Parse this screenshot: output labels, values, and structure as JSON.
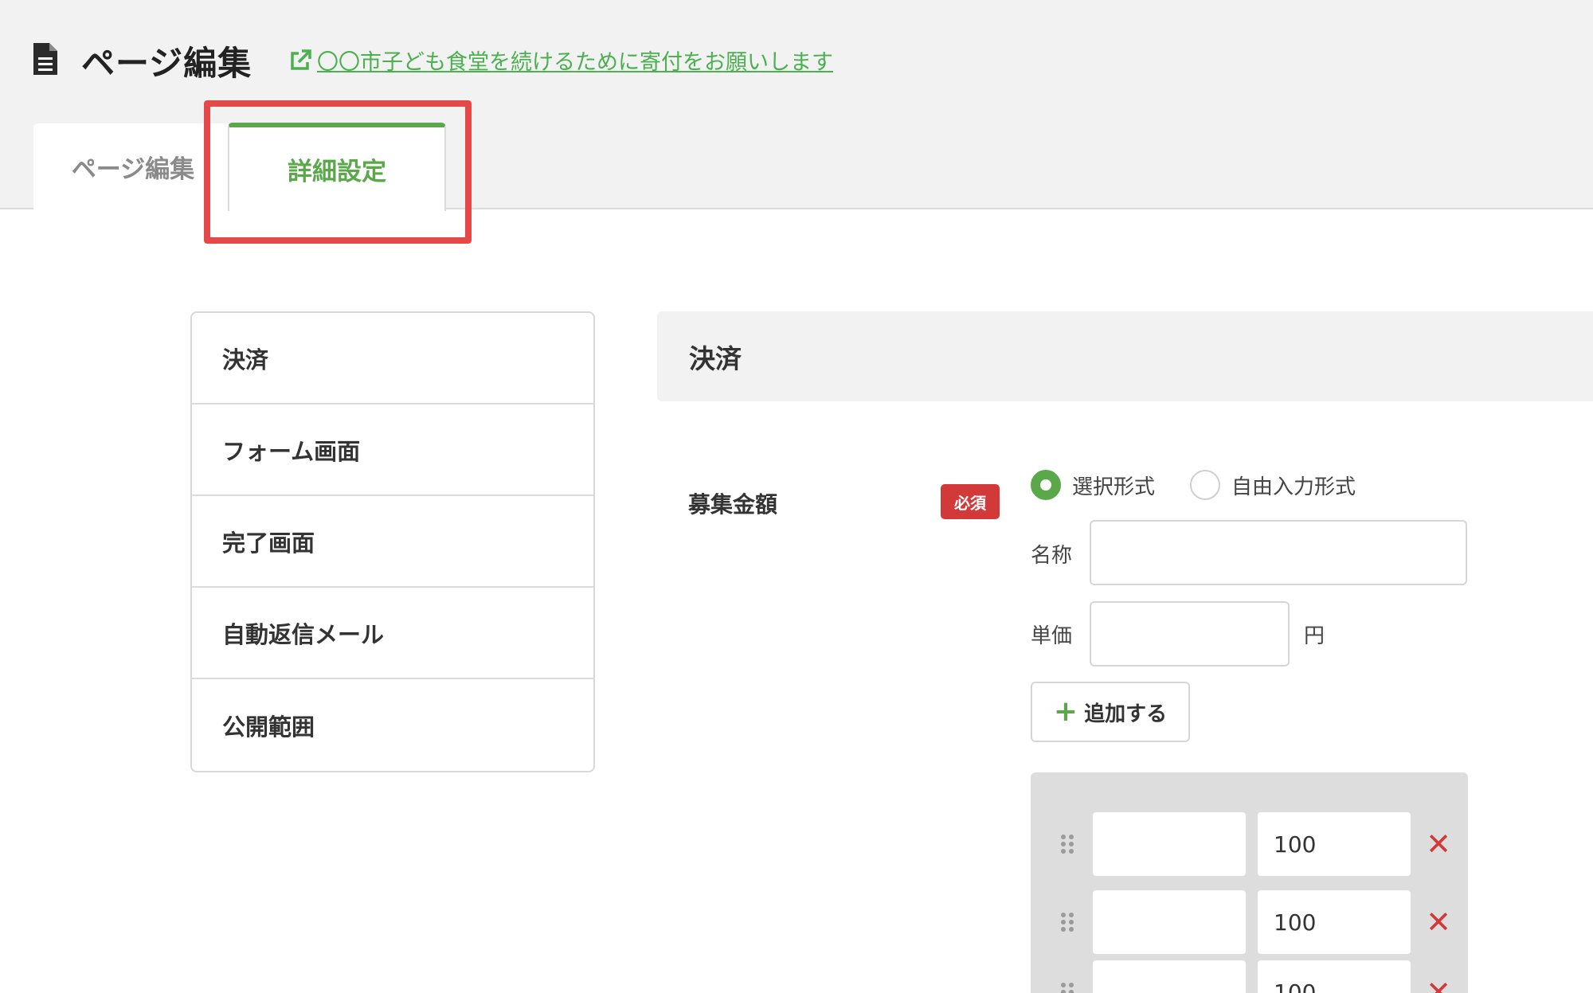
{
  "header": {
    "title": "ページ編集",
    "page_link": "〇〇市子ども食堂を続けるために寄付をお願いします"
  },
  "tabs": [
    {
      "label": "ページ編集",
      "active": false
    },
    {
      "label": "詳細設定",
      "active": true
    }
  ],
  "sidebar": {
    "items": [
      {
        "label": "決済"
      },
      {
        "label": "フォーム画面"
      },
      {
        "label": "完了画面"
      },
      {
        "label": "自動返信メール"
      },
      {
        "label": "公開範囲"
      }
    ]
  },
  "section": {
    "title": "決済",
    "field_label": "募集金額",
    "required_badge": "必須",
    "radio_options": [
      {
        "label": "選択形式",
        "checked": true
      },
      {
        "label": "自由入力形式",
        "checked": false
      }
    ],
    "name_label": "名称",
    "name_value": "",
    "price_label": "単価",
    "price_value": "",
    "yen_label": "円",
    "add_label": "追加する",
    "amount_rows": [
      {
        "name": "",
        "price": "100"
      },
      {
        "name": "",
        "price": "100"
      },
      {
        "name": "",
        "price": "100"
      }
    ]
  },
  "colors": {
    "accent_green": "#5aa84a",
    "required_red": "#d23a3a",
    "highlight_red": "#e64848",
    "header_bg": "#f2f2f2"
  },
  "icons": {
    "header": "document-icon",
    "link": "external-link-icon",
    "add": "plus-icon",
    "row_drag": "drag-handle-icon",
    "row_delete": "delete-x-icon"
  }
}
